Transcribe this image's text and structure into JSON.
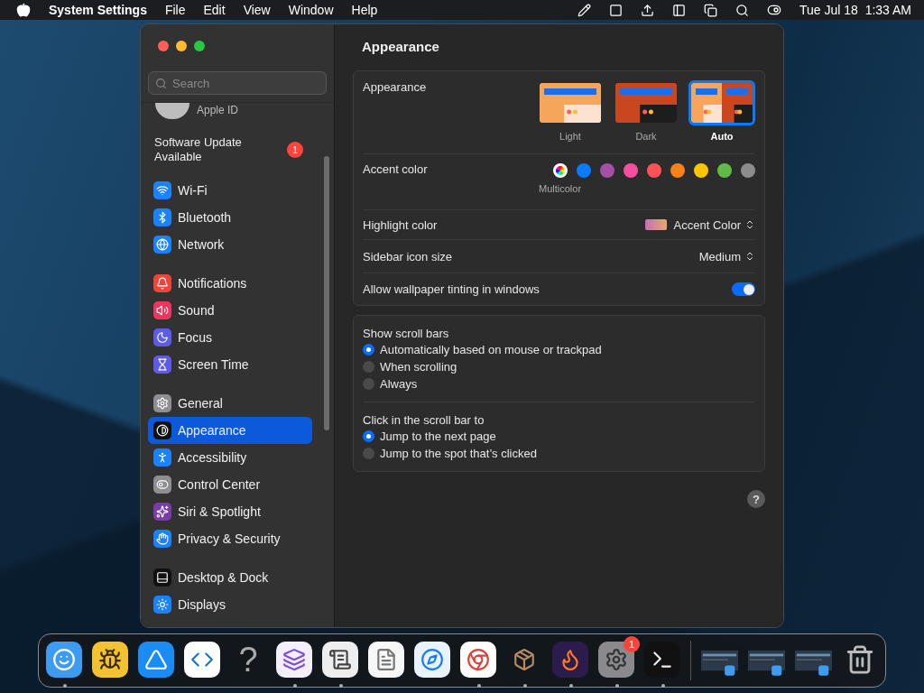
{
  "menu_bar": {
    "app_name": "System Settings",
    "menus": [
      "File",
      "Edit",
      "View",
      "Window",
      "Help"
    ],
    "clock": "Tue Jul 18  1:33 AM"
  },
  "sidebar": {
    "search": {
      "placeholder": "Search"
    },
    "apple_id": "Apple ID",
    "update": {
      "label": "Software Update Available",
      "badge": "1"
    },
    "groups": [
      [
        {
          "label": "Wi-Fi",
          "kind": "wifi",
          "selected": false
        },
        {
          "label": "Bluetooth",
          "kind": "bluetooth",
          "selected": false
        },
        {
          "label": "Network",
          "kind": "globe",
          "selected": false
        }
      ],
      [
        {
          "label": "Notifications",
          "kind": "bell",
          "selected": false
        },
        {
          "label": "Sound",
          "kind": "speaker",
          "selected": false
        },
        {
          "label": "Focus",
          "kind": "moon",
          "selected": false
        },
        {
          "label": "Screen Time",
          "kind": "hourglass",
          "selected": false
        }
      ],
      [
        {
          "label": "General",
          "kind": "gear",
          "selected": false
        },
        {
          "label": "Appearance",
          "kind": "contrast",
          "selected": true
        },
        {
          "label": "Accessibility",
          "kind": "person",
          "selected": false
        },
        {
          "label": "Control Center",
          "kind": "toggles",
          "selected": false
        },
        {
          "label": "Siri & Spotlight",
          "kind": "sparkles",
          "selected": false
        },
        {
          "label": "Privacy & Security",
          "kind": "hand",
          "selected": false
        }
      ],
      [
        {
          "label": "Desktop & Dock",
          "kind": "dock",
          "selected": false
        },
        {
          "label": "Displays",
          "kind": "sun",
          "selected": false
        }
      ]
    ]
  },
  "content": {
    "title": "Appearance",
    "appearance": {
      "label": "Appearance",
      "modes": [
        {
          "label": "Light",
          "kind": "light",
          "selected": false
        },
        {
          "label": "Dark",
          "kind": "dark",
          "selected": false
        },
        {
          "label": "Auto",
          "kind": "auto",
          "selected": true
        }
      ]
    },
    "accent": {
      "label": "Accent color",
      "caption": "Multicolor",
      "colors": [
        {
          "kind": "multi",
          "selected": true
        },
        {
          "color": "#0a7aff",
          "selected": false
        },
        {
          "color": "#a550a7",
          "selected": false
        },
        {
          "color": "#f74f9e",
          "selected": false
        },
        {
          "color": "#ff5257",
          "selected": false
        },
        {
          "color": "#f7821b",
          "selected": false
        },
        {
          "color": "#ffc600",
          "selected": false
        },
        {
          "color": "#62ba46",
          "selected": false
        },
        {
          "color": "#8c8c8c",
          "selected": false
        }
      ]
    },
    "highlight": {
      "label": "Highlight color",
      "value": "Accent Color"
    },
    "icon_size": {
      "label": "Sidebar icon size",
      "value": "Medium"
    },
    "tinting": {
      "label": "Allow wallpaper tinting in windows",
      "on": true
    },
    "radio_groups": [
      {
        "title": "Show scroll bars",
        "options": [
          {
            "label": "Automatically based on mouse or trackpad",
            "selected": true
          },
          {
            "label": "When scrolling",
            "selected": false
          },
          {
            "label": "Always",
            "selected": false
          }
        ]
      },
      {
        "title": "Click in the scroll bar to",
        "options": [
          {
            "label": "Jump to the next page",
            "selected": true
          },
          {
            "label": "Jump to the spot that’s clicked",
            "selected": false
          }
        ]
      }
    ],
    "help": "?"
  },
  "dock": {
    "apps": [
      {
        "kind": "finder",
        "running": true
      },
      {
        "kind": "bee",
        "running": false
      },
      {
        "kind": "store",
        "running": false
      },
      {
        "kind": "code",
        "running": false
      },
      {
        "kind": "glyph",
        "glyph": "?",
        "running": false
      },
      {
        "kind": "studio",
        "running": true
      },
      {
        "kind": "script",
        "running": true
      },
      {
        "kind": "notes",
        "running": false
      },
      {
        "kind": "safari",
        "running": false
      },
      {
        "kind": "chrome",
        "running": true
      },
      {
        "kind": "box",
        "running": true
      },
      {
        "kind": "firefox",
        "running": true
      },
      {
        "kind": "settings",
        "running": true,
        "badge": "1"
      },
      {
        "kind": "terminal",
        "running": true
      }
    ],
    "windows": [
      {
        "kind": "window"
      },
      {
        "kind": "window"
      },
      {
        "kind": "window"
      }
    ]
  }
}
